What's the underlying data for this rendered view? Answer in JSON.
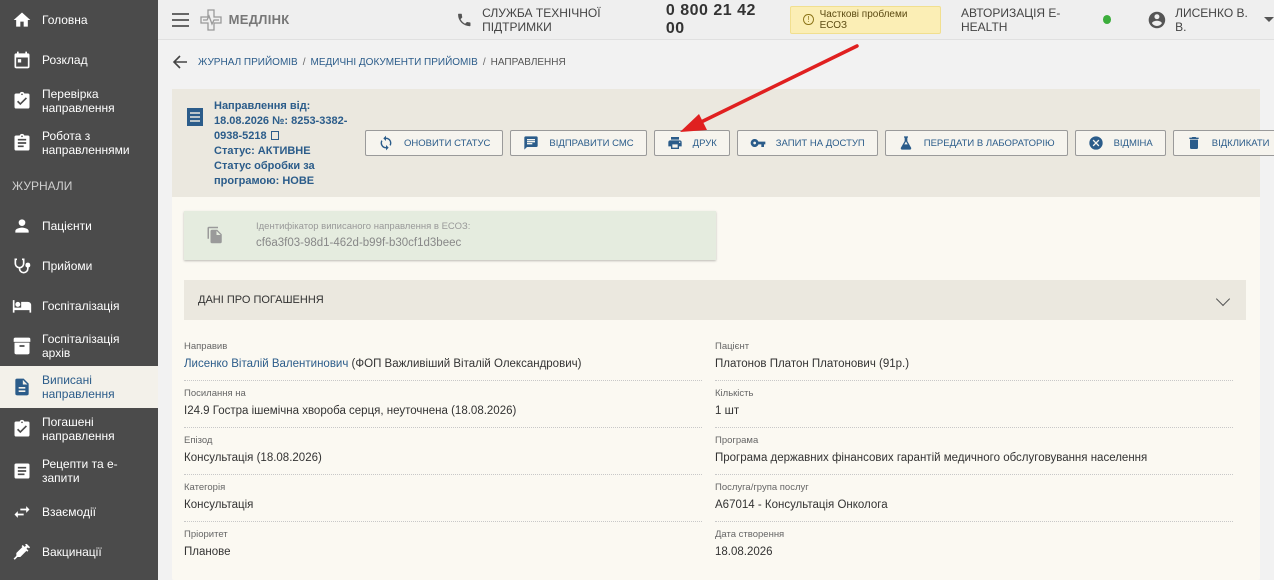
{
  "sidebar": {
    "items_top": [
      {
        "label": "Головна",
        "icon": "home-icon"
      },
      {
        "label": "Розклад",
        "icon": "calendar-icon"
      },
      {
        "label": "Перевірка направлення",
        "icon": "clipboard-check-icon"
      },
      {
        "label": "Робота з направленнями",
        "icon": "clipboard-list-icon"
      }
    ],
    "section": "ЖУРНАЛИ",
    "items": [
      {
        "label": "Пацієнти",
        "icon": "person-icon"
      },
      {
        "label": "Прийоми",
        "icon": "stethoscope-icon"
      },
      {
        "label": "Госпіталізація",
        "icon": "bed-icon"
      },
      {
        "label": "Госпіталізація архів",
        "icon": "archive-icon"
      },
      {
        "label": "Виписані направлення",
        "icon": "document-icon",
        "active": true
      },
      {
        "label": "Погашені направлення",
        "icon": "clipboard-done-icon"
      },
      {
        "label": "Рецепти та е-запити",
        "icon": "list-icon"
      },
      {
        "label": "Взаємодії",
        "icon": "swap-icon"
      },
      {
        "label": "Вакцинації",
        "icon": "syringe-icon"
      }
    ]
  },
  "topbar": {
    "brand": "МЕДЛІНК",
    "support_label": "СЛУЖБА ТЕХНІЧНОЇ ПІДТРИМКИ",
    "support_phone": "0 800 21 42 00",
    "warning": "Часткові проблеми ЕСОЗ",
    "ehealth": "АВТОРИЗАЦІЯ E-HEALTH",
    "user": "ЛИСЕНКО В. В."
  },
  "breadcrumb": {
    "items": [
      "ЖУРНАЛ ПРИЙОМІВ",
      "МЕДИЧНІ ДОКУМЕНТИ ПРИЙОМІВ"
    ],
    "current": "НАПРАВЛЕННЯ"
  },
  "header": {
    "line1": "Направлення від:",
    "line2": "18.08.2026 №: 8253-3382-",
    "line3": "0938-5218",
    "status": "Статус: АКТИВНЕ",
    "processing": "Статус обробки за програмою: НОВЕ"
  },
  "actions": [
    {
      "label": "ОНОВИТИ СТАТУС",
      "icon": "refresh-icon"
    },
    {
      "label": "ВІДПРАВИТИ СМС",
      "icon": "sms-icon"
    },
    {
      "label": "ДРУК",
      "icon": "printer-icon"
    },
    {
      "label": "ЗАПИТ НА ДОСТУП",
      "icon": "key-icon"
    },
    {
      "label": "ПЕРЕДАТИ В ЛАБОРАТОРІЮ",
      "icon": "flask-icon"
    },
    {
      "label": "ВІДМІНА",
      "icon": "cancel-icon"
    },
    {
      "label": "ВІДКЛИКАТИ",
      "icon": "trash-icon"
    }
  ],
  "id_card": {
    "label": "Ідентифікатор виписаного направлення в ЕСОЗ:",
    "value": "cf6a3f03-98d1-462d-b99f-b30cf1d3beec"
  },
  "accordion": {
    "title": "ДАНІ ПРО ПОГАШЕННЯ"
  },
  "fields": {
    "directed_by": {
      "label": "Направив",
      "link": "Лисенко Віталій Валентинович",
      "extra": " (ФОП Важливіший Віталій Олександрович)"
    },
    "patient": {
      "label": "Пацієнт",
      "value": "Платонов Платон Платонович (91р.)"
    },
    "reference": {
      "label": "Посилання на",
      "value": "I24.9 Гостра ішемічна хвороба серця, неуточнена (18.08.2026)"
    },
    "quantity": {
      "label": "Кількість",
      "value": "1 шт"
    },
    "episode": {
      "label": "Епізод",
      "value": "Консультація (18.08.2026)"
    },
    "program": {
      "label": "Програма",
      "value": "Програма державних фінансових гарантій медичного обслуговування населення"
    },
    "category": {
      "label": "Категорія",
      "value": "Консультація"
    },
    "service": {
      "label": "Послуга/група послуг",
      "value": "A67014 - Консультація Онколога"
    },
    "priority": {
      "label": "Пріоритет",
      "value": "Планове"
    },
    "created": {
      "label": "Дата створення",
      "value": "18.08.2026"
    }
  },
  "colors": {
    "accent": "#2b5c8a",
    "sidebar": "#4b4b4b",
    "arrow": "#e02020"
  }
}
